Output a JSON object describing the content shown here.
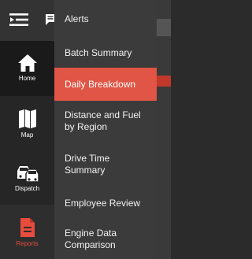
{
  "colors": {
    "rail_bg": "#262626",
    "menu_bg": "#3b3b3b",
    "accent": "#e05545",
    "text": "#f2f2f2"
  },
  "rail": {
    "items": [
      {
        "label": "Home",
        "icon": "home-icon"
      },
      {
        "label": "Map",
        "icon": "map-icon"
      },
      {
        "label": "Dispatch",
        "icon": "dispatch-icon"
      },
      {
        "label": "Reports",
        "icon": "reports-icon",
        "active": true
      }
    ]
  },
  "submenu": {
    "items": [
      {
        "label": "Alerts"
      },
      {
        "label": "Batch Summary"
      },
      {
        "label": "Daily Breakdown",
        "selected": true
      },
      {
        "label": "Distance and Fuel by Region"
      },
      {
        "label": "Drive Time Summary"
      },
      {
        "label": "Employee Review"
      },
      {
        "label": "Engine Data Comparison"
      }
    ]
  }
}
